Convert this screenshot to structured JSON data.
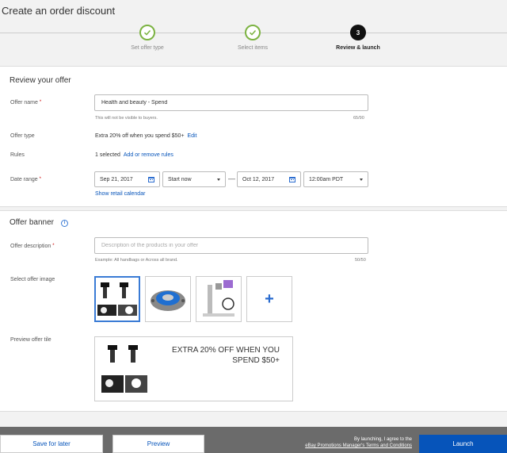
{
  "page": {
    "title": "Create an order discount"
  },
  "stepper": {
    "steps": [
      {
        "label": "Set offer type",
        "status": "done",
        "icon": "check-icon"
      },
      {
        "label": "Select items",
        "status": "done",
        "icon": "check-icon"
      },
      {
        "label": "Review & launch",
        "status": "current",
        "number": "3"
      }
    ]
  },
  "review": {
    "title": "Review your offer",
    "offer_name": {
      "label": "Offer name",
      "required": "*",
      "value": "Health and beauty - Spend",
      "hint": "This will not be visible to buyers.",
      "count": "65/90"
    },
    "offer_type": {
      "label": "Offer type",
      "value": "Extra 20% off when you spend $50+",
      "edit_link": "Edit"
    },
    "rules": {
      "label": "Rules",
      "value": "1 selected",
      "link": "Add or remove rules"
    },
    "date_range": {
      "label": "Date range",
      "required": "*",
      "start_date": "Sep 21, 2017",
      "start_time": "Start now",
      "separator": "—",
      "end_date": "Oct 12, 2017",
      "end_time": "12:00am PDT",
      "calendar_link": "Show retail calendar"
    }
  },
  "banner": {
    "title": "Offer banner",
    "info_icon": "i",
    "description": {
      "label": "Offer description",
      "required": "*",
      "placeholder": "Description of the products in your offer",
      "hint": "Example: All handbags or Across all brand.",
      "count": "50/50"
    },
    "image": {
      "label": "Select offer image",
      "thumbnails": [
        {
          "name": "led-headlight-bulbs",
          "selected": true
        },
        {
          "name": "wheel-hub-assembly",
          "selected": false
        },
        {
          "name": "water-filter-system",
          "selected": false
        }
      ],
      "add_label": "+"
    },
    "preview": {
      "label": "Preview offer tile",
      "text": "EXTRA 20% OFF WHEN YOU SPEND $50+"
    }
  },
  "footer": {
    "save_label": "Save for later",
    "preview_label": "Preview",
    "agree_text": "By launching, I agree to the",
    "terms_link": "eBay Promotions Manager's Terms and Conditions",
    "launch_label": "Launch"
  },
  "colors": {
    "accent": "#0654ba",
    "done": "#7cb342",
    "footer_bg": "#6b6b6b"
  }
}
